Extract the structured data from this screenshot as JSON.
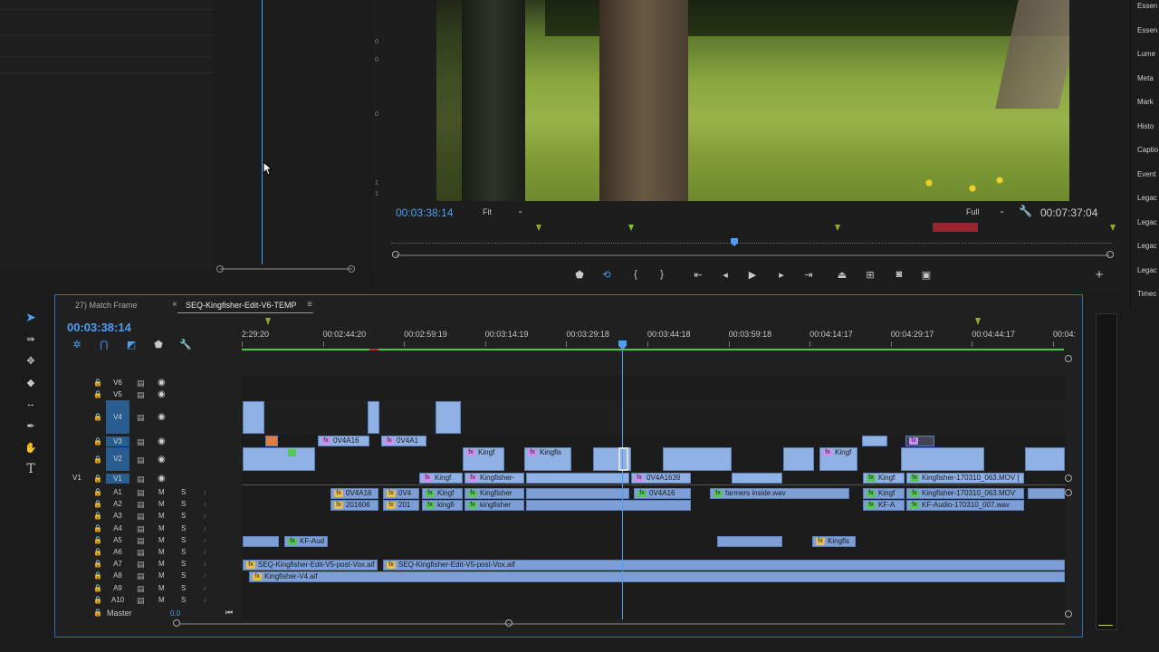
{
  "program_monitor": {
    "current_time": "00:03:38:14",
    "fit_select": "Fit",
    "resolution_select": "Full",
    "duration": "00:07:37:04"
  },
  "right_panel": {
    "items": [
      "Essen",
      "Essen",
      "Lume",
      "Meta",
      "Mark",
      "Histo",
      "Captio",
      "Event",
      "Legac",
      "Legac",
      "Legac",
      "Legac",
      "Timec"
    ]
  },
  "timeline": {
    "tabs": [
      {
        "label": "27) Match Frame"
      },
      {
        "label": "SEQ-Kingfisher-Edit-V6-TEMP"
      }
    ],
    "close_glyph": "×",
    "menu_glyph": "≡",
    "current_time": "00:03:38:14",
    "ruler": [
      "2:29:20",
      "00:02:44:20",
      "00:02:59:19",
      "00:03:14:19",
      "00:03:29:18",
      "00:03:44:18",
      "00:03:59:18",
      "00:04:14:17",
      "00:04:29:17",
      "00:04:44:17",
      "00:04:"
    ],
    "video_tracks": [
      "V6",
      "V5",
      "V4",
      "V3",
      "V2",
      "V1"
    ],
    "source_patch": "V1",
    "audio_tracks": [
      "A1",
      "A2",
      "A3",
      "A4",
      "A5",
      "A6",
      "A7",
      "A8",
      "A9",
      "A10"
    ],
    "mute_label": "M",
    "solo_label": "S",
    "master_label": "Master",
    "master_value": "0.0",
    "clips": {
      "v3a": "0V4A16",
      "v3b": "0V4A1",
      "v2a": "Kingf",
      "v2b": "Kingfis",
      "v2c": "Kingf",
      "v1a": "Kingf",
      "v1b": "Kingfisher-",
      "v1c": "0V4A1639",
      "v1d": "Kingf",
      "v1e": "Kingfisher-170310_063.MOV [",
      "a1a": "0V4A16",
      "a1b": "0V4",
      "a1c": "Kingf",
      "a1d": "Kingfisher",
      "a1e": "0V4A16",
      "a1f": "farmers inside.wav",
      "a1g": "Kingf",
      "a1h": "Kingfisher-170310_063.MOV",
      "a2a": "201606",
      "a2b": "201",
      "a2c": "kingfi",
      "a2d": "kingfisher",
      "a2e": "KF-A",
      "a2f": "KF-Audio-170310_007.wav",
      "a5a": "KF-Aud",
      "a5b": "Kingfis",
      "a7a": "SEQ-Kingfisher-Edit-V5-post-Vox.aif",
      "a7b": "SEQ-Kingfisher-Edit-V5-post-Vox.aif",
      "a8a": "Kingfisher-V4.aif"
    }
  },
  "tools": [
    "selection",
    "track-select",
    "ripple-edit",
    "razor",
    "slip",
    "pen",
    "hand",
    "type"
  ],
  "colors": {
    "accent": "#4c9ff5",
    "clip_video": "#8fb1e4",
    "playhead": "#4c9ff5",
    "work_area": "#3bd13b"
  }
}
